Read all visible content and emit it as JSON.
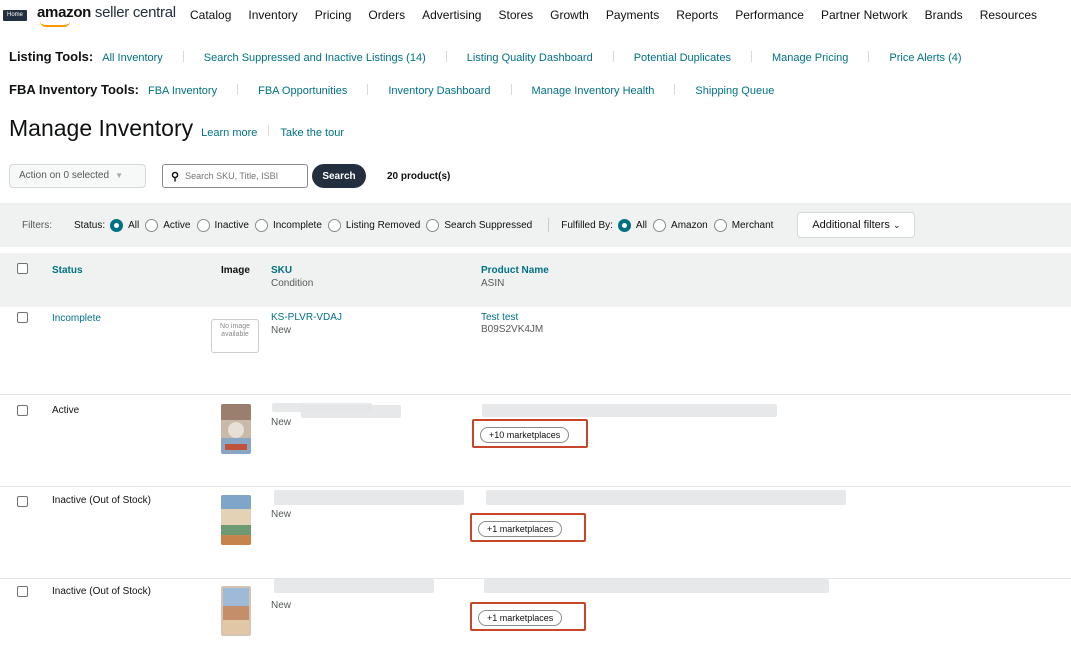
{
  "topbar": {
    "home_label": "Home",
    "logo_brand": "amazon",
    "logo_product": " seller central",
    "nav": [
      "Catalog",
      "Inventory",
      "Pricing",
      "Orders",
      "Advertising",
      "Stores",
      "Growth",
      "Payments",
      "Reports",
      "Performance",
      "Partner Network",
      "Brands",
      "Resources"
    ]
  },
  "listing_tools": {
    "label": "Listing Tools:",
    "links": [
      "All Inventory",
      "Search Suppressed and Inactive Listings (14)",
      "Listing Quality Dashboard",
      "Potential Duplicates",
      "Manage Pricing",
      "Price Alerts (4)"
    ]
  },
  "fba_tools": {
    "label": "FBA Inventory Tools:",
    "links": [
      "FBA Inventory",
      "FBA Opportunities",
      "Inventory Dashboard",
      "Manage Inventory Health",
      "Shipping Queue"
    ]
  },
  "page": {
    "title": "Manage Inventory",
    "learn_more": "Learn more",
    "take_tour": "Take the tour"
  },
  "actions": {
    "action_select": "Action on 0 selected",
    "search_placeholder": "Search SKU, Title, ISBI",
    "search_button": "Search",
    "product_count": "20 product(s)"
  },
  "filters": {
    "label": "Filters:",
    "status_label": "Status:",
    "status_options": [
      "All",
      "Active",
      "Inactive",
      "Incomplete",
      "Listing Removed",
      "Search Suppressed"
    ],
    "status_selected": "All",
    "fulfilled_label": "Fulfilled By:",
    "fulfilled_options": [
      "All",
      "Amazon",
      "Merchant"
    ],
    "fulfilled_selected": "All",
    "additional": "Additional filters"
  },
  "table": {
    "col_status": "Status",
    "col_image": "Image",
    "col_sku": "SKU",
    "col_condition": "Condition",
    "col_product": "Product Name",
    "col_asin": "ASIN",
    "rows": [
      {
        "status": "Incomplete",
        "sku": "KS-PLVR-VDAJ",
        "condition": "New",
        "product": "Test test",
        "asin": "B09S2VK4JM",
        "no_image": "No image available",
        "marketplaces": ""
      },
      {
        "status": "Active",
        "sku": "",
        "condition": "New",
        "product": "",
        "asin": "",
        "no_image": "",
        "marketplaces": "+10 marketplaces"
      },
      {
        "status": "Inactive (Out of Stock)",
        "sku": "",
        "condition": "New",
        "product": "",
        "asin": "",
        "no_image": "",
        "marketplaces": "+1 marketplaces"
      },
      {
        "status": "Inactive (Out of Stock)",
        "sku": "",
        "condition": "New",
        "product": "",
        "asin": "",
        "no_image": "",
        "marketplaces": "+1 marketplaces"
      }
    ]
  },
  "colors": {
    "link": "#007185",
    "dark_nav": "#232f3e",
    "brand_orange": "#ff9900",
    "highlight_box": "#c7462a",
    "filter_bg": "#f0f2f2"
  }
}
